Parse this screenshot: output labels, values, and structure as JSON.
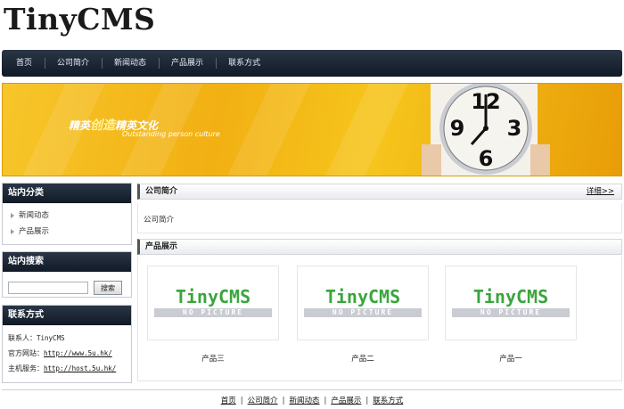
{
  "site": {
    "logo": "TinyCMS"
  },
  "nav": {
    "items": [
      {
        "label": "首页"
      },
      {
        "label": "公司简介"
      },
      {
        "label": "新闻动态"
      },
      {
        "label": "产品展示"
      },
      {
        "label": "联系方式"
      }
    ]
  },
  "banner": {
    "title_a": "精英",
    "title_hl": "创造",
    "title_b": "精英文化",
    "subtitle": "Outstanding person culture"
  },
  "sidebar": {
    "categories": {
      "title": "站内分类",
      "items": [
        {
          "label": "新闻动态"
        },
        {
          "label": "产品展示"
        }
      ]
    },
    "search": {
      "title": "站内搜索",
      "input_value": "",
      "button_label": "搜索"
    },
    "contact": {
      "title": "联系方式",
      "person_label": "联系人：",
      "person": "TinyCMS",
      "site_label": "官方网站：",
      "site_url": "http://www.5u.hk/",
      "host_label": "主机服务：",
      "host_url": "http://host.5u.hk/"
    }
  },
  "intro": {
    "title": "公司简介",
    "more": "详细>>",
    "body": "公司简介"
  },
  "products": {
    "title": "产品展示",
    "placeholder_big": "TinyCMS",
    "placeholder_small": "NO PICTURE",
    "items": [
      {
        "name": "产品三"
      },
      {
        "name": "产品二"
      },
      {
        "name": "产品一"
      }
    ]
  },
  "footer": {
    "links": [
      {
        "label": "首页"
      },
      {
        "label": "公司简介"
      },
      {
        "label": "新闻动态"
      },
      {
        "label": "产品展示"
      },
      {
        "label": "联系方式"
      }
    ],
    "separator": "|"
  },
  "colors": {
    "nav_bg": "#1a2433",
    "banner": "#f2b013",
    "placeholder_green": "#3aa53e"
  }
}
